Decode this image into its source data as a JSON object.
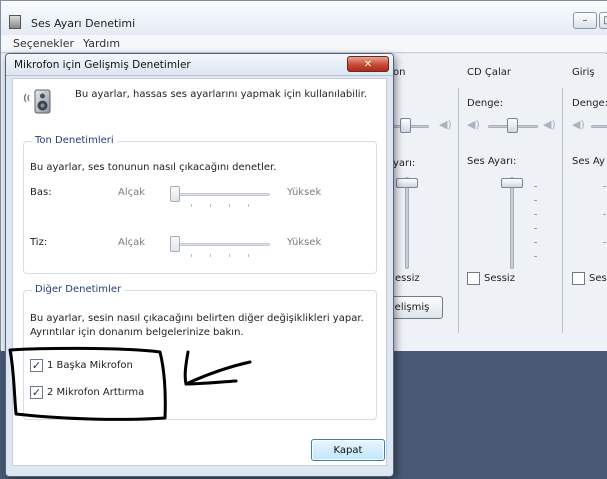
{
  "main_window": {
    "title": "Ses Ayarı Denetimi",
    "title_buttons": {
      "minimize": "–",
      "maximize": "□"
    },
    "menu": [
      "Seçenekler",
      "Yardım"
    ],
    "columns": [
      {
        "header_partial": "on",
        "volume_label_partial": "yarı:",
        "mute_label_partial": "essiz",
        "button_label_partial": "elişmiş"
      },
      {
        "header": "CD Çalar",
        "balance_label": "Denge:",
        "volume_label": "Ses Ayarı:",
        "mute_label": "Sessiz",
        "mute_checked": false
      },
      {
        "header": "Giriş",
        "balance_label": "Denge:",
        "volume_label_partial": "Ses Ay",
        "mute_label_partial": "Ses",
        "mute_checked": false
      }
    ]
  },
  "dialog": {
    "title": "Mikrofon için Gelişmiş Denetimler",
    "close_glyph": "✕",
    "intro": "Bu ayarlar, hassas ses ayarlarını yapmak için kullanılabilir.",
    "tone_group": {
      "title": "Ton Denetimleri",
      "description": "Bu ayarlar, ses tonunun nasıl çıkacağını denetler.",
      "sliders": [
        {
          "label": "Bas:",
          "min_label": "Alçak",
          "max_label": "Yüksek",
          "value": 0.0
        },
        {
          "label": "Tiz:",
          "min_label": "Alçak",
          "max_label": "Yüksek",
          "value": 0.0
        }
      ]
    },
    "other_group": {
      "title": "Diğer Denetimler",
      "description_line1": "Bu ayarlar, sesin nasıl çıkacağını belirten diğer değişiklikleri yapar.",
      "description_line2": "Ayrıntılar için donanım belgelerinize bakın.",
      "checkboxes": [
        {
          "label": "1  Başka Mikrofon",
          "checked": true
        },
        {
          "label": "2  Mikrofon Arttırma",
          "checked": true
        }
      ]
    },
    "close_button": "Kapat"
  },
  "colors": {
    "annotation": "#000000",
    "group_title": "#25407c",
    "close_x_red": "#c54a36",
    "primary_button": "#bee6fd"
  },
  "icons": {
    "dialog_speaker": "speaker-icon",
    "mixer_balance": "speaker-icon",
    "dialog_close": "close-icon"
  }
}
